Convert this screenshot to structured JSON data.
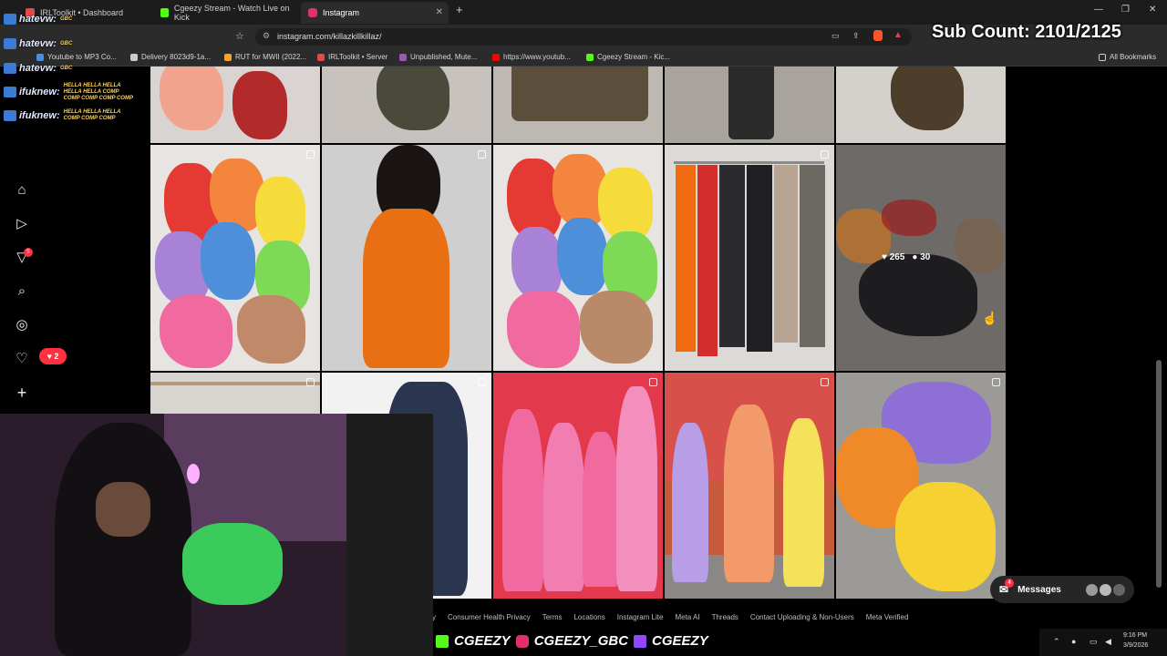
{
  "browser": {
    "tabs": [
      {
        "label": "IRLToolkit • Dashboard",
        "color": "#e34b4b"
      },
      {
        "label": "Cgeezy Stream - Watch Live on Kick",
        "color": "#53fc18"
      },
      {
        "label": "Instagram",
        "color": "#e1306c"
      }
    ],
    "url": "instagram.com/killazkillkillaz/",
    "bookmarks": [
      {
        "label": "Youtube to MP3 Co...",
        "color": "#4a90e2"
      },
      {
        "label": "Delivery 8023d9-1a...",
        "color": "#cccccc"
      },
      {
        "label": "RUT for MWII (2022...",
        "color": "#f5a623"
      },
      {
        "label": "IRLToolkit • Server",
        "color": "#e34b4b"
      },
      {
        "label": "Unpublished, Mute...",
        "color": "#9b59b6"
      },
      {
        "label": "https://www.youtub...",
        "color": "#ff0000"
      },
      {
        "label": "Cgeezy Stream - Kic...",
        "color": "#53fc18"
      },
      {
        "label": "All Bookmarks",
        "color": "#cccccc"
      }
    ]
  },
  "instagram": {
    "notification_count": "2",
    "activity_badge": "5",
    "hover_likes": "265",
    "hover_comments": "30",
    "messages_label": "Messages",
    "messages_badge": "4",
    "footer_links": [
      "cy",
      "Consumer Health Privacy",
      "Terms",
      "Locations",
      "Instagram Lite",
      "Meta AI",
      "Threads",
      "Contact Uploading & Non-Users",
      "Meta Verified"
    ]
  },
  "overlay": {
    "sub_count": "Sub Count: 2101/2125",
    "chat": [
      {
        "user": "hatevw:",
        "tag": "GBC"
      },
      {
        "user": "hatevw:",
        "tag": "GBC"
      },
      {
        "user": "hatevw:",
        "tag": "GBC"
      },
      {
        "user": "ifuknew:",
        "tag": "HELLA HELLA HELLA HELLA HELLA COMP COMP COMP COMP COMP"
      },
      {
        "user": "ifuknew:",
        "tag": "HELLA HELLA HELLA COMP COMP COMP"
      }
    ],
    "socials": [
      "CGEEZY",
      "CGEEZY_GBC",
      "CGEEZY"
    ]
  },
  "taskbar": {
    "time": "9:16 PM",
    "date": "3/9/2026"
  }
}
